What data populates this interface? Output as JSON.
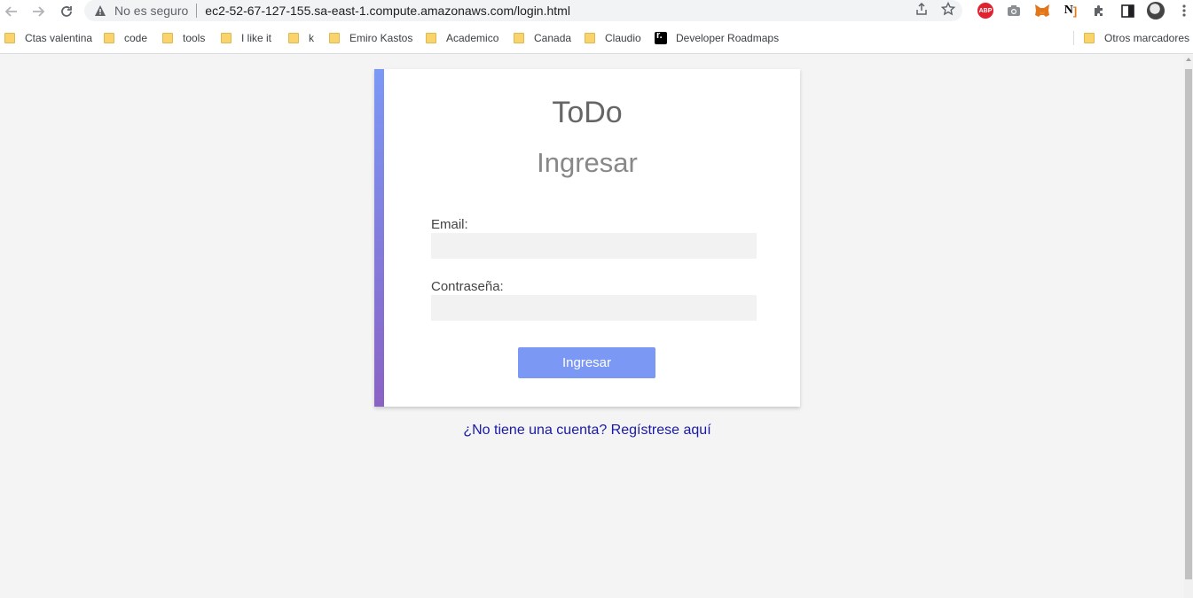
{
  "browser": {
    "security_label": "No es seguro",
    "url": "ec2-52-67-127-155.sa-east-1.compute.amazonaws.com/login.html",
    "icons": [
      "back-arrow-icon",
      "forward-arrow-icon",
      "reload-icon",
      "warning-icon",
      "share-icon",
      "star-icon",
      "abp-icon",
      "camera-icon",
      "metamask-icon",
      "notion-icon",
      "puzzle-icon",
      "sidepanel-icon",
      "profile-avatar",
      "kebab-menu-icon"
    ],
    "abp_label": "ABP",
    "notion_label": "N"
  },
  "bookmarks": [
    {
      "label": "Ctas valentina"
    },
    {
      "label": "code"
    },
    {
      "label": "tools"
    },
    {
      "label": "I like it"
    },
    {
      "label": "k"
    },
    {
      "label": "Emiro Kastos"
    },
    {
      "label": "Academico"
    },
    {
      "label": "Canada"
    },
    {
      "label": "Claudio"
    },
    {
      "label": "Developer Roadmaps"
    },
    {
      "label": "Otros marcadores"
    }
  ],
  "page": {
    "app_title": "ToDo",
    "form_title": "Ingresar",
    "email_label": "Email:",
    "email_value": "",
    "password_label": "Contraseña:",
    "password_value": "",
    "submit_label": "Ingresar",
    "register_link": "¿No tiene una cuenta? Regístrese aquí",
    "colors": {
      "accent": "#7b98f5",
      "accent_bottom": "#8a62c4",
      "link": "#1a1aa6",
      "background": "#f4f4f4"
    }
  }
}
